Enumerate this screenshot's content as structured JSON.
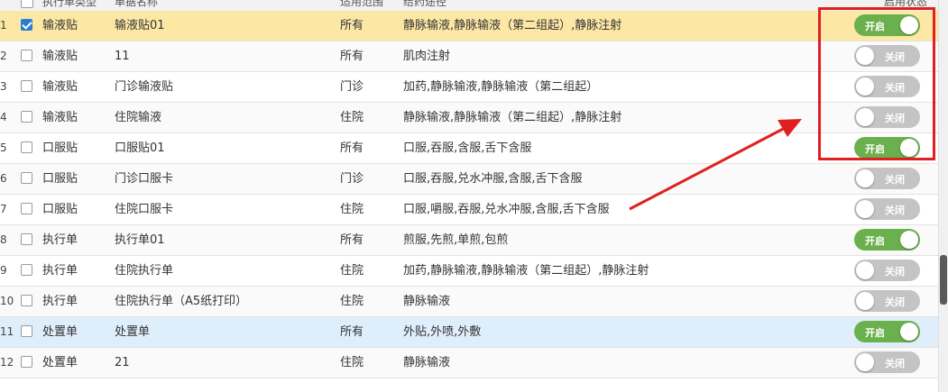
{
  "header": {
    "cols": [
      "执行单类型",
      "单据名称",
      "适用范围",
      "给药途径",
      "启用状态"
    ]
  },
  "rows": [
    {
      "idx": "1",
      "checked": true,
      "type": "输液贴",
      "name": "输液贴01",
      "scope": "所有",
      "route": "静脉输液,静脉输液（第二组起）,静脉注射",
      "status": "on"
    },
    {
      "idx": "2",
      "checked": false,
      "type": "输液贴",
      "name": "11",
      "scope": "所有",
      "route": "肌肉注射",
      "status": "off"
    },
    {
      "idx": "3",
      "checked": false,
      "type": "输液贴",
      "name": "门诊输液贴",
      "scope": "门诊",
      "route": "加药,静脉输液,静脉输液（第二组起）",
      "status": "off"
    },
    {
      "idx": "4",
      "checked": false,
      "type": "输液贴",
      "name": "住院输液",
      "scope": "住院",
      "route": "静脉输液,静脉输液（第二组起）,静脉注射",
      "status": "off"
    },
    {
      "idx": "5",
      "checked": false,
      "type": "口服贴",
      "name": "口服贴01",
      "scope": "所有",
      "route": "口服,吞服,含服,舌下含服",
      "status": "on"
    },
    {
      "idx": "6",
      "checked": false,
      "type": "口服贴",
      "name": "门诊口服卡",
      "scope": "门诊",
      "route": "口服,吞服,兑水冲服,含服,舌下含服",
      "status": "off"
    },
    {
      "idx": "7",
      "checked": false,
      "type": "口服贴",
      "name": "住院口服卡",
      "scope": "住院",
      "route": "口服,嚼服,吞服,兑水冲服,含服,舌下含服",
      "status": "off"
    },
    {
      "idx": "8",
      "checked": false,
      "type": "执行单",
      "name": "执行单01",
      "scope": "所有",
      "route": "煎服,先煎,单煎,包煎",
      "status": "on"
    },
    {
      "idx": "9",
      "checked": false,
      "type": "执行单",
      "name": "住院执行单",
      "scope": "住院",
      "route": "加药,静脉输液,静脉输液（第二组起）,静脉注射",
      "status": "off"
    },
    {
      "idx": "10",
      "checked": false,
      "type": "执行单",
      "name": "住院执行单（A5纸打印）",
      "scope": "住院",
      "route": "静脉输液",
      "status": "off"
    },
    {
      "idx": "11",
      "checked": false,
      "type": "处置单",
      "name": "处置单",
      "scope": "所有",
      "route": "外贴,外喷,外敷",
      "status": "on"
    },
    {
      "idx": "12",
      "checked": false,
      "type": "处置单",
      "name": "21",
      "scope": "住院",
      "route": "静脉输液",
      "status": "off"
    }
  ],
  "toggle_labels": {
    "on": "开启",
    "off": "关闭"
  },
  "colors": {
    "selected_row": "#fde7a5",
    "hover_row": "#dfeefb",
    "toggle_on": "#6ab04c",
    "toggle_off": "#c4c4c4",
    "annotation": "#e02020"
  }
}
